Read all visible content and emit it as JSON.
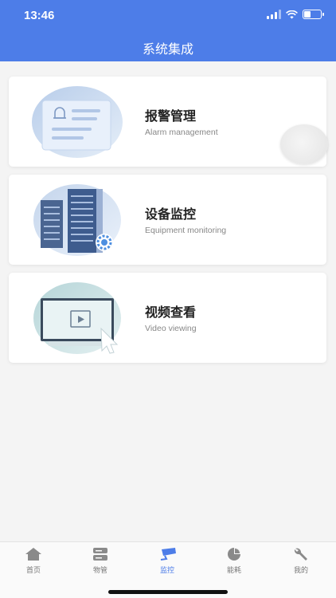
{
  "status_bar": {
    "time": "13:46"
  },
  "header": {
    "title": "系统集成"
  },
  "cards": [
    {
      "title": "报警管理",
      "subtitle": "Alarm management"
    },
    {
      "title": "设备监控",
      "subtitle": "Equipment monitoring"
    },
    {
      "title": "视频查看",
      "subtitle": "Video viewing"
    }
  ],
  "tabbar": {
    "active_color": "#4d7de8",
    "items": [
      {
        "label": "首页",
        "icon": "home-icon"
      },
      {
        "label": "物管",
        "icon": "server-icon"
      },
      {
        "label": "监控",
        "icon": "camera-icon"
      },
      {
        "label": "能耗",
        "icon": "pie-chart-icon"
      },
      {
        "label": "我的",
        "icon": "wrench-icon"
      }
    ],
    "active_index": 2
  }
}
